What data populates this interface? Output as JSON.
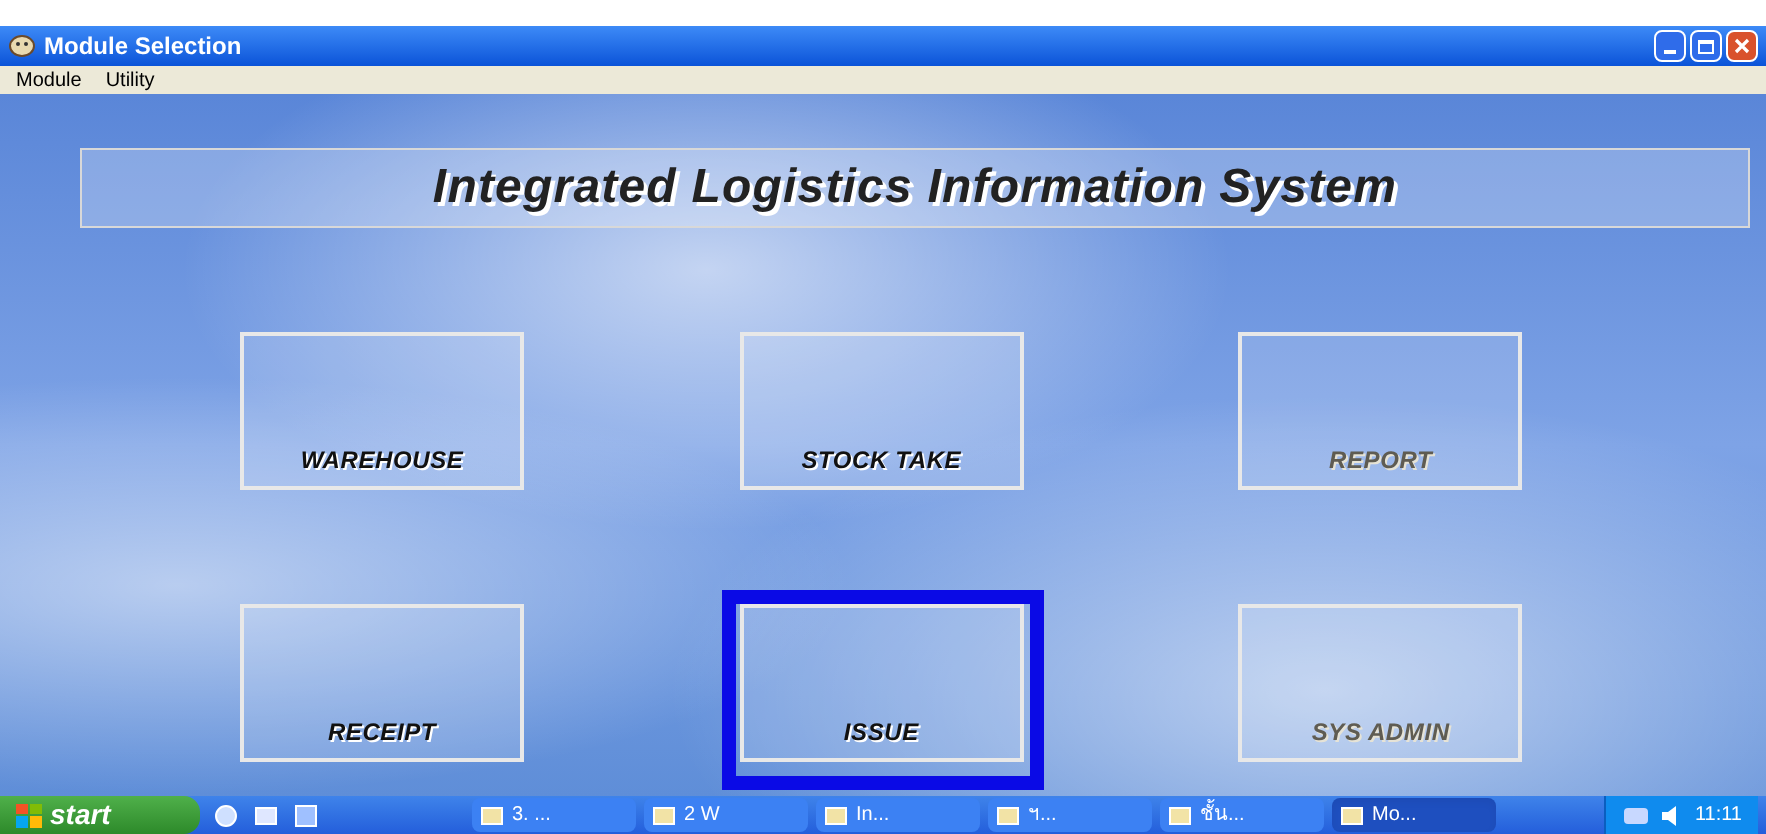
{
  "window": {
    "title": "Module Selection"
  },
  "menu": [
    "Module",
    "Utility"
  ],
  "banner": "Integrated Logistics Information System",
  "modules": [
    {
      "label": "WAREHOUSE",
      "disabled": false,
      "selected": false
    },
    {
      "label": "STOCK TAKE",
      "disabled": false,
      "selected": false
    },
    {
      "label": "REPORT",
      "disabled": true,
      "selected": false
    },
    {
      "label": "RECEIPT",
      "disabled": false,
      "selected": false
    },
    {
      "label": "ISSUE",
      "disabled": false,
      "selected": true
    },
    {
      "label": "SYS ADMIN",
      "disabled": true,
      "selected": false
    }
  ],
  "taskbar": {
    "start": "start",
    "buttons": [
      {
        "label": "3. ...",
        "selected": false
      },
      {
        "label": "2 W",
        "selected": false
      },
      {
        "label": "In...",
        "selected": false
      },
      {
        "label": "ฯ...",
        "selected": false
      },
      {
        "label": "ชั้น...",
        "selected": false
      },
      {
        "label": "Mo...",
        "selected": true
      }
    ],
    "clock": "11:11"
  }
}
